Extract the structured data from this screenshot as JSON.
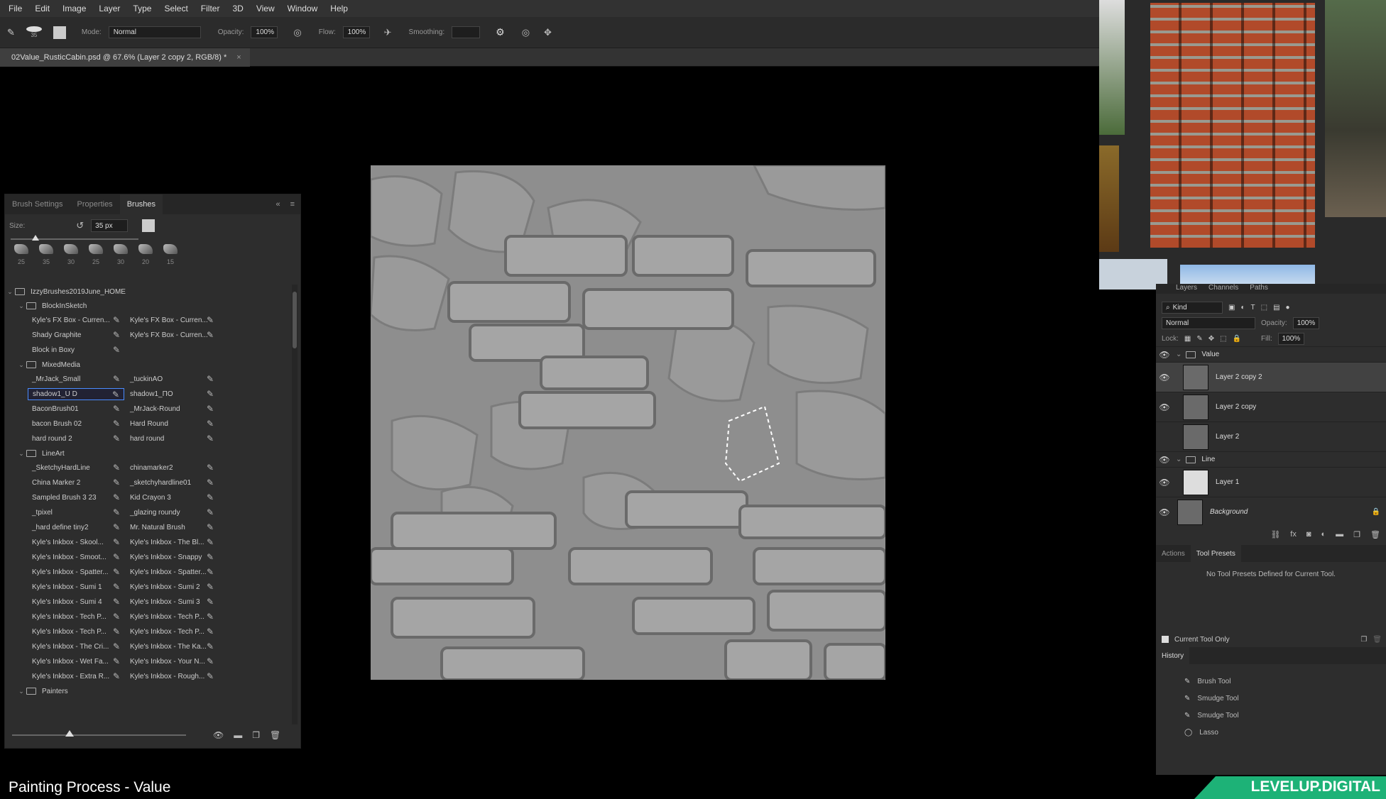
{
  "menu": [
    "File",
    "Edit",
    "Image",
    "Layer",
    "Type",
    "Select",
    "Filter",
    "3D",
    "View",
    "Window",
    "Help"
  ],
  "options": {
    "brush_size": "35",
    "mode_label": "Mode:",
    "mode_value": "Normal",
    "opacity_label": "Opacity:",
    "opacity_value": "100%",
    "flow_label": "Flow:",
    "flow_value": "100%",
    "smoothing_label": "Smoothing:"
  },
  "document": {
    "tab_title": "02Value_RusticCabin.psd @ 67.6% (Layer 2 copy 2, RGB/8) *",
    "close": "×"
  },
  "brush_panel": {
    "tabs": [
      "Brush Settings",
      "Properties",
      "Brushes"
    ],
    "size_label": "Size:",
    "size_value": "35 px",
    "recent_sizes": [
      "25",
      "35",
      "30",
      "25",
      "30",
      "20",
      "15"
    ],
    "root_folder": "IzzyBrushes2019June_HOME",
    "groups": [
      {
        "name": "BlockInSketch",
        "rows": [
          [
            "Kyle's FX Box - Curren...",
            "Kyle's FX Box - Curren..."
          ],
          [
            "Shady Graphite",
            "Kyle's FX Box - Curren..."
          ],
          [
            "Block in Boxy",
            ""
          ]
        ]
      },
      {
        "name": "MixedMedia",
        "rows": [
          [
            "_MrJack_Small",
            "_tuckinAO"
          ],
          [
            "shadow1_U D",
            "shadow1_ΠO"
          ],
          [
            "BaconBrush01",
            "_MrJack-Round"
          ],
          [
            "bacon Brush 02",
            "Hard Round"
          ],
          [
            "hard round 2",
            "hard round"
          ]
        ]
      },
      {
        "name": "LineArt",
        "rows": [
          [
            "_SketchyHardLine",
            "chinamarker2"
          ],
          [
            "China Marker 2",
            "_sketchyhardline01"
          ],
          [
            "Sampled Brush 3 23",
            "Kid Crayon 3"
          ],
          [
            "_tpixel",
            "_glazing roundy"
          ],
          [
            "_hard define tiny2",
            "Mr. Natural Brush"
          ],
          [
            "Kyle's Inkbox - Skool...",
            "Kyle's Inkbox - The Bl..."
          ],
          [
            "Kyle's Inkbox - Smoot...",
            "Kyle's Inkbox - Snappy"
          ],
          [
            "Kyle's Inkbox - Spatter...",
            "Kyle's Inkbox - Spatter..."
          ],
          [
            "Kyle's Inkbox - Sumi 1",
            "Kyle's Inkbox - Sumi 2"
          ],
          [
            "Kyle's Inkbox - Sumi 4",
            "Kyle's Inkbox - Sumi 3"
          ],
          [
            "Kyle's Inkbox - Tech P...",
            "Kyle's Inkbox - Tech P..."
          ],
          [
            "Kyle's Inkbox - Tech P...",
            "Kyle's Inkbox - Tech P..."
          ],
          [
            "Kyle's Inkbox - The Cri...",
            "Kyle's Inkbox - The Ka..."
          ],
          [
            "Kyle's Inkbox - Wet Fa...",
            "Kyle's Inkbox - Your N..."
          ],
          [
            "Kyle's Inkbox - Extra R...",
            "Kyle's Inkbox - Rough..."
          ]
        ]
      },
      {
        "name": "Painters",
        "rows": []
      }
    ]
  },
  "layers_panel": {
    "tabs": [
      "Layers",
      "Channels",
      "Paths"
    ],
    "kind": "Kind",
    "blend": "Normal",
    "opacity_label": "Opacity:",
    "opacity_value": "100%",
    "lock_label": "Lock:",
    "fill_label": "Fill:",
    "fill_value": "100%",
    "group_value": "Value",
    "layer_l2c2": "Layer 2 copy 2",
    "layer_l2c": "Layer 2 copy",
    "layer_l2": "Layer 2",
    "group_line": "Line",
    "layer_l1": "Layer 1",
    "layer_bg": "Background"
  },
  "actions_panel": {
    "tabs": [
      "Actions",
      "Tool Presets"
    ],
    "message": "No Tool Presets Defined for Current Tool.",
    "current_tool_only": "Current Tool Only"
  },
  "history_panel": {
    "title": "History",
    "items": [
      "Brush Tool",
      "Smudge Tool",
      "Smudge Tool",
      "Lasso"
    ]
  },
  "caption": {
    "title": "Painting Process - Value",
    "brand": "LEVELUP.DIGITAL"
  },
  "colors": {
    "accent": "#1db277",
    "selection": "#4a8cff"
  }
}
